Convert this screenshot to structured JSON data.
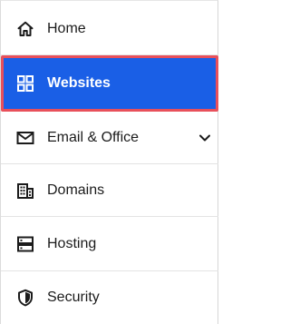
{
  "nav": {
    "items": [
      {
        "label": "Home",
        "icon": "home-icon"
      },
      {
        "label": "Websites",
        "icon": "websites-grid-icon",
        "active": true
      },
      {
        "label": "Email & Office",
        "icon": "envelope-icon",
        "expandable": true
      },
      {
        "label": "Domains",
        "icon": "domains-building-icon"
      },
      {
        "label": "Hosting",
        "icon": "server-icon"
      },
      {
        "label": "Security",
        "icon": "shield-icon"
      }
    ]
  },
  "colors": {
    "active_bg": "#1a5fe6",
    "active_border": "#e8505b",
    "text": "#1b1b1b",
    "divider": "#e3e3e3"
  }
}
